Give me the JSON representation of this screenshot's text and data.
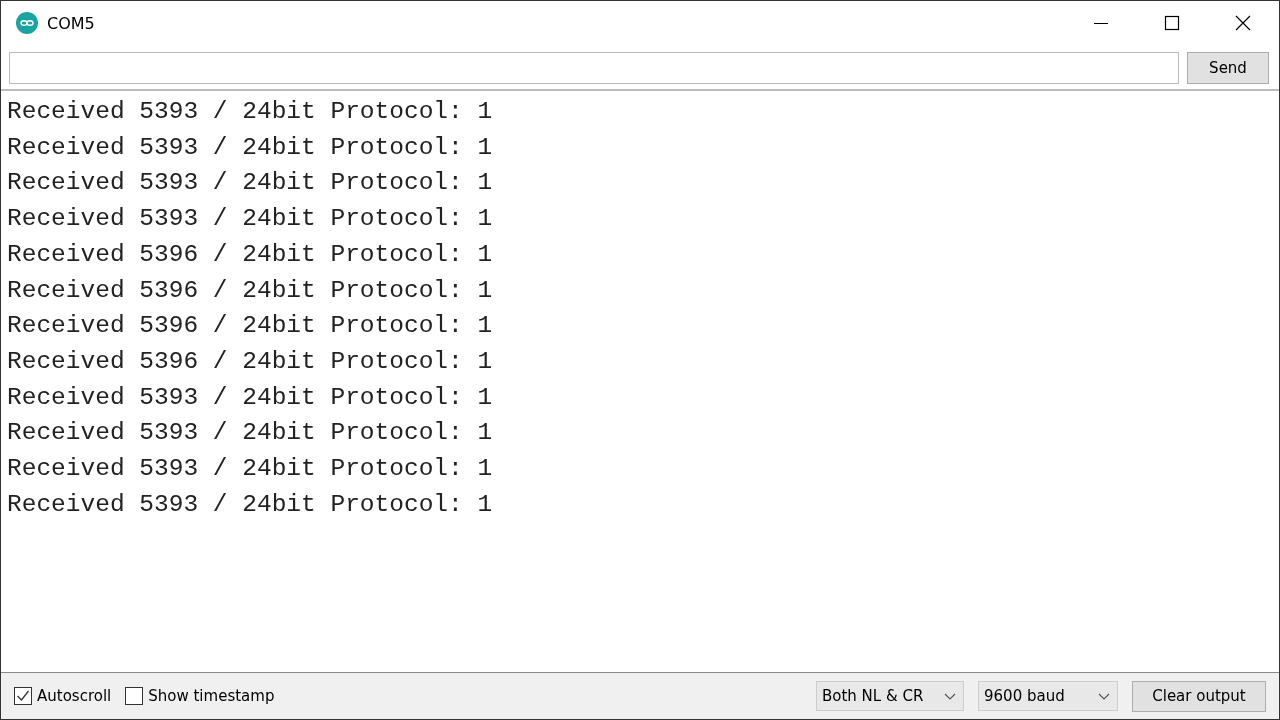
{
  "window": {
    "title": "COM5"
  },
  "send_button": "Send",
  "output": [
    "Received 5393 / 24bit Protocol: 1",
    "Received 5393 / 24bit Protocol: 1",
    "Received 5393 / 24bit Protocol: 1",
    "Received 5393 / 24bit Protocol: 1",
    "Received 5396 / 24bit Protocol: 1",
    "Received 5396 / 24bit Protocol: 1",
    "Received 5396 / 24bit Protocol: 1",
    "Received 5396 / 24bit Protocol: 1",
    "Received 5393 / 24bit Protocol: 1",
    "Received 5393 / 24bit Protocol: 1",
    "Received 5393 / 24bit Protocol: 1",
    "Received 5393 / 24bit Protocol: 1"
  ],
  "options": [
    {
      "label": "Autoscroll",
      "checked": true
    },
    {
      "label": "Show timestamp",
      "checked": false
    }
  ],
  "line_ending": "Both NL & CR",
  "baud_rate": "9600 baud",
  "clear_button": "Clear output"
}
